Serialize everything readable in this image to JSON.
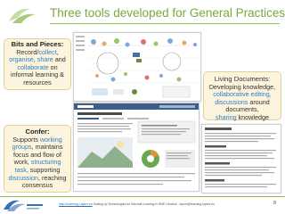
{
  "title": "Three tools developed for General Practices",
  "callouts": {
    "bits": {
      "heading": "Bits and Pieces:",
      "l1": "Record/",
      "l1b": "collect",
      "l1c": ",",
      "l2a": "organise",
      "l2b": ", ",
      "l2c": "share",
      "l2d": " and",
      "l3a": "collaborate",
      "l3b": " on",
      "l4": "informal learning &",
      "l5": "resources"
    },
    "living": {
      "heading": "Living Documents:",
      "l1": "Developing knowledge,",
      "l2": "collaborative editing,",
      "l3a": "discussions",
      "l3b": " around documents,",
      "l4a": "sharing",
      "l4b": " knowledge"
    },
    "confer": {
      "heading": "Confer:",
      "l1": "Supports ",
      "l1b": "working",
      "l2a": "groups",
      "l2b": ", maintains",
      "l3": "focus and flow of",
      "l4a": "work, ",
      "l4b": "structuring",
      "l5a": "task",
      "l5b": ", supporting",
      "l6a": "discussion",
      "l6b": ", reaching",
      "l7": "consensus"
    }
  },
  "footer": {
    "link": "http://Learning-Layers.eu",
    "text": "  Scaling up Technologies for Informal Learning in SME Clusters  -  layers@learning-layers.eu",
    "page": "8"
  },
  "colors": {
    "title": "#78a83e",
    "highlight": "#2b7fbf",
    "callout_bg": "#fdf4de"
  }
}
